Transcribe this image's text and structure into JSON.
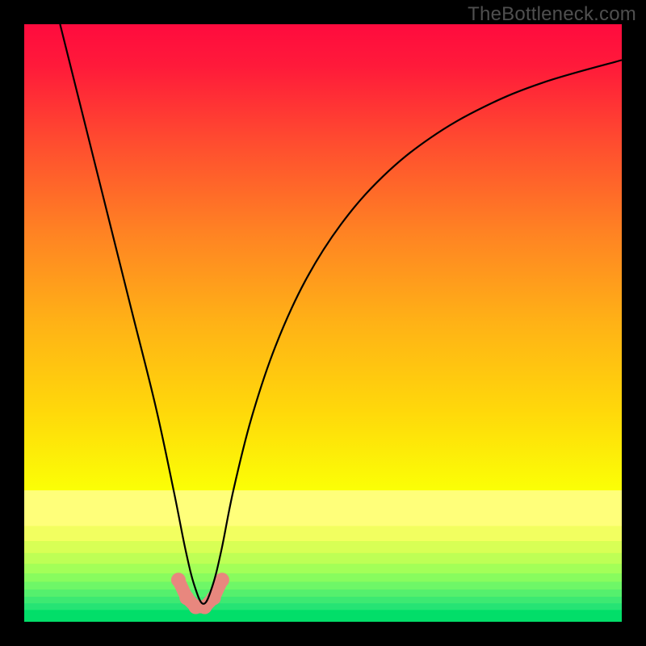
{
  "watermark": "TheBottleneck.com",
  "chart_data": {
    "type": "line",
    "title": "",
    "xlabel": "",
    "ylabel": "",
    "xlim": [
      0,
      100
    ],
    "ylim": [
      0,
      100
    ],
    "gradient_stops": [
      {
        "offset": 0.0,
        "color": "#ff0b3e"
      },
      {
        "offset": 0.07,
        "color": "#ff1a3a"
      },
      {
        "offset": 0.2,
        "color": "#ff4d2f"
      },
      {
        "offset": 0.35,
        "color": "#ff8323"
      },
      {
        "offset": 0.5,
        "color": "#ffb216"
      },
      {
        "offset": 0.65,
        "color": "#ffd90a"
      },
      {
        "offset": 0.78,
        "color": "#fbff06"
      },
      {
        "offset": 0.86,
        "color": "#e4ff2a"
      },
      {
        "offset": 0.92,
        "color": "#b6ff4a"
      },
      {
        "offset": 0.96,
        "color": "#7cff68"
      },
      {
        "offset": 0.985,
        "color": "#34f57e"
      },
      {
        "offset": 1.0,
        "color": "#02e465"
      }
    ],
    "gradient_bands": [
      {
        "y": 0.78,
        "h": 0.06,
        "color": "#ffff7a"
      },
      {
        "y": 0.84,
        "h": 0.025,
        "color": "#f2ff60"
      },
      {
        "y": 0.865,
        "h": 0.02,
        "color": "#d8ff55"
      },
      {
        "y": 0.885,
        "h": 0.018,
        "color": "#beff55"
      },
      {
        "y": 0.903,
        "h": 0.016,
        "color": "#a3ff58"
      },
      {
        "y": 0.919,
        "h": 0.014,
        "color": "#88fc5e"
      },
      {
        "y": 0.933,
        "h": 0.013,
        "color": "#6ef767"
      },
      {
        "y": 0.946,
        "h": 0.012,
        "color": "#55f06d"
      },
      {
        "y": 0.958,
        "h": 0.011,
        "color": "#3de972"
      },
      {
        "y": 0.969,
        "h": 0.011,
        "color": "#26e374"
      },
      {
        "y": 0.98,
        "h": 0.02,
        "color": "#02de69"
      }
    ],
    "series": [
      {
        "name": "bottleneck-curve",
        "x": [
          6.0,
          10.0,
          14.0,
          18.0,
          22.0,
          25.0,
          27.0,
          28.5,
          30.0,
          31.5,
          33.0,
          35.0,
          38.0,
          42.0,
          47.0,
          53.0,
          60.0,
          68.0,
          77.0,
          87.0,
          100.0
        ],
        "y": [
          100.0,
          84.0,
          68.0,
          52.0,
          36.0,
          22.0,
          12.0,
          6.0,
          3.0,
          6.0,
          12.0,
          22.0,
          34.0,
          46.0,
          57.0,
          66.5,
          74.5,
          81.0,
          86.2,
          90.3,
          94.0
        ]
      }
    ],
    "markers": {
      "name": "valley-markers",
      "color": "#e8877e",
      "radius": 9,
      "points": [
        {
          "x": 25.8,
          "y": 7.0
        },
        {
          "x": 27.2,
          "y": 4.0
        },
        {
          "x": 28.7,
          "y": 2.5
        },
        {
          "x": 30.2,
          "y": 2.5
        },
        {
          "x": 31.7,
          "y": 4.0
        },
        {
          "x": 33.1,
          "y": 7.0
        }
      ]
    },
    "valley_path": {
      "color": "#e8877e",
      "width": 16,
      "points": [
        {
          "x": 25.8,
          "y": 7.0
        },
        {
          "x": 27.2,
          "y": 4.0
        },
        {
          "x": 28.7,
          "y": 2.5
        },
        {
          "x": 30.2,
          "y": 2.5
        },
        {
          "x": 31.7,
          "y": 4.0
        },
        {
          "x": 33.1,
          "y": 7.0
        }
      ]
    }
  }
}
